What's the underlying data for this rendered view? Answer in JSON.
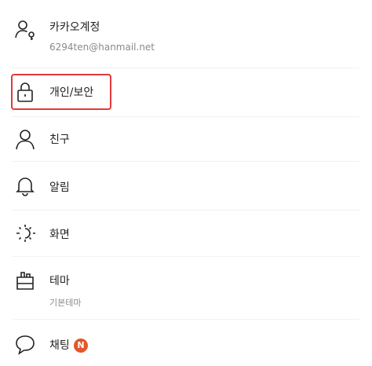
{
  "settings": {
    "items": [
      {
        "label": "카카오계정",
        "sub": "6294ten@hanmail.net",
        "icon": "person-key-icon"
      },
      {
        "label": "개인/보안",
        "icon": "lock-icon"
      },
      {
        "label": "친구",
        "icon": "person-icon"
      },
      {
        "label": "알림",
        "icon": "bell-icon"
      },
      {
        "label": "화면",
        "icon": "sun-icon"
      },
      {
        "label": "테마",
        "sub": "기본테마",
        "icon": "paintbrush-icon"
      },
      {
        "label": "채팅",
        "badge": "N",
        "icon": "chat-bubble-icon"
      }
    ]
  },
  "colors": {
    "highlight": "#e23a3a",
    "badge": "#e2572b",
    "text": "#222222",
    "subtext": "#8a8a8a"
  }
}
